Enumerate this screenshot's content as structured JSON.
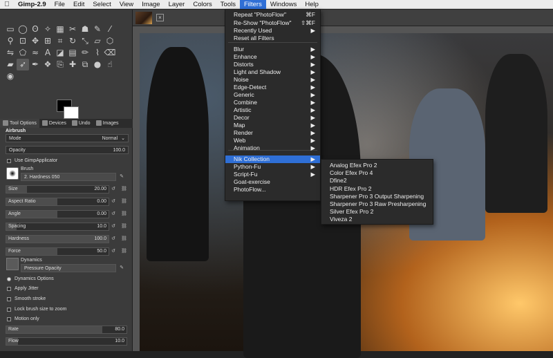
{
  "menubar": {
    "items": [
      "Gimp-2.9",
      "File",
      "Edit",
      "Select",
      "View",
      "Image",
      "Layer",
      "Colors",
      "Tools",
      "Filters",
      "Windows",
      "Help"
    ]
  },
  "toolbox": {
    "tabs": [
      "Tool Options",
      "Devices",
      "Undo",
      "Images"
    ],
    "tool_name": "Airbrush",
    "mode_label": "Mode",
    "mode_value": "Normal",
    "opacity_label": "Opacity",
    "opacity_value": "100.0",
    "use_gimpapplicator": "Use GimpApplicator",
    "brush_label": "Brush",
    "brush_value": "2. Hardness 050",
    "sliders": [
      {
        "label": "Size",
        "value": "20.00",
        "level": 0.2
      },
      {
        "label": "Aspect Ratio",
        "value": "0.00",
        "level": 0.5
      },
      {
        "label": "Angle",
        "value": "0.00",
        "level": 0.5
      },
      {
        "label": "Spacing",
        "value": "10.0",
        "level": 0.1
      },
      {
        "label": "Hardness",
        "value": "100.0",
        "level": 1.0
      },
      {
        "label": "Force",
        "value": "50.0",
        "level": 0.5
      }
    ],
    "dynamics_label": "Dynamics",
    "dynamics_value": "Pressure Opacity",
    "dynamics_options": "Dynamics Options",
    "apply_jitter": "Apply Jitter",
    "smooth_stroke": "Smooth stroke",
    "lock_brush": "Lock brush size to zoom",
    "motion_only": "Motion only",
    "rate_label": "Rate",
    "rate_value": "80.0",
    "rate_level": 0.8,
    "flow_label": "Flow",
    "flow_value": "10.0",
    "flow_level": 0.1
  },
  "filters_menu": {
    "items": [
      {
        "label": "Repeat \"PhotoFlow\"",
        "shortcut": "⌘F"
      },
      {
        "label": "Re-Show \"PhotoFlow\"",
        "shortcut": "⇧⌘F"
      },
      {
        "label": "Recently Used",
        "shortcut": "▶"
      },
      {
        "label": "Reset all Filters",
        "shortcut": ""
      },
      {
        "label": "Blur",
        "shortcut": "▶"
      },
      {
        "label": "Enhance",
        "shortcut": "▶"
      },
      {
        "label": "Distorts",
        "shortcut": "▶"
      },
      {
        "label": "Light and Shadow",
        "shortcut": "▶"
      },
      {
        "label": "Noise",
        "shortcut": "▶"
      },
      {
        "label": "Edge-Detect",
        "shortcut": "▶"
      },
      {
        "label": "Generic",
        "shortcut": "▶"
      },
      {
        "label": "Combine",
        "shortcut": "▶"
      },
      {
        "label": "Artistic",
        "shortcut": "▶"
      },
      {
        "label": "Decor",
        "shortcut": "▶"
      },
      {
        "label": "Map",
        "shortcut": "▶"
      },
      {
        "label": "Render",
        "shortcut": "▶"
      },
      {
        "label": "Web",
        "shortcut": "▶"
      },
      {
        "label": "Animation",
        "shortcut": "▶"
      },
      {
        "label": "Nik Collection",
        "shortcut": "▶"
      },
      {
        "label": "Python-Fu",
        "shortcut": "▶"
      },
      {
        "label": "Script-Fu",
        "shortcut": "▶"
      },
      {
        "label": "Goat-exercise",
        "shortcut": ""
      },
      {
        "label": "PhotoFlow...",
        "shortcut": ""
      }
    ]
  },
  "nik_submenu": {
    "items": [
      "Analog Efex Pro 2",
      "Color Efex Pro 4",
      "Dfine2",
      "HDR Efex Pro 2",
      "Sharpener Pro 3 Output Sharpening",
      "Sharpener Pro 3 Raw Presharpening",
      "Silver Efex Pro 2",
      "Viveza 2"
    ]
  },
  "colors": {
    "accent": "#2f6fd6",
    "menu_bg": "#2b2b2b",
    "panel_bg": "#3b3b3b"
  }
}
